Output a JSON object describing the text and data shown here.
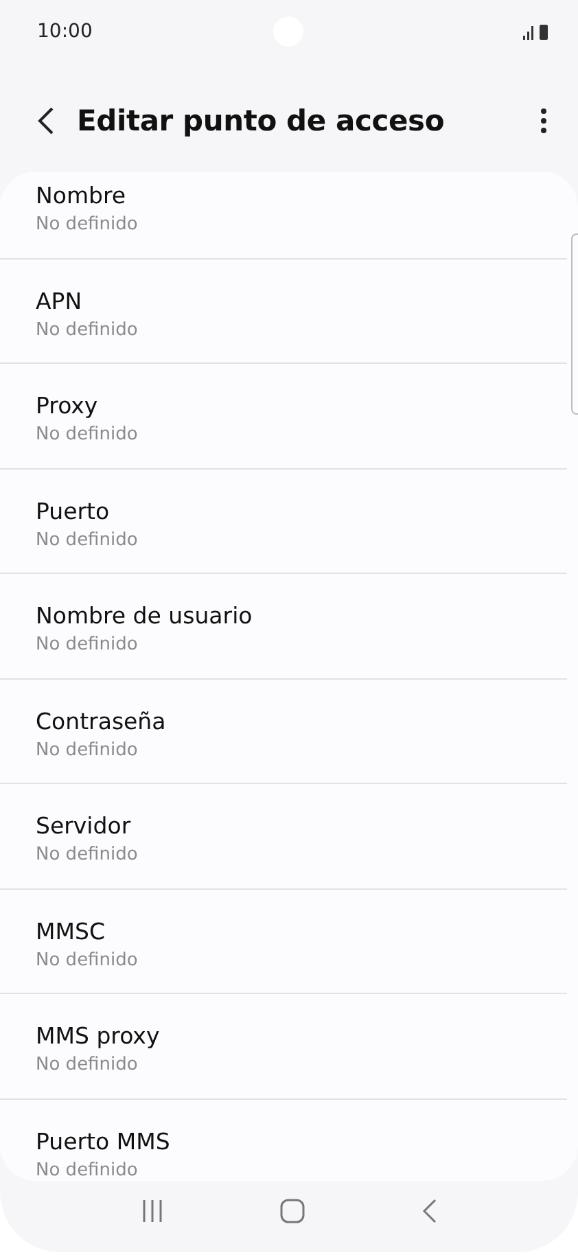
{
  "status_bar": {
    "time": "10:00"
  },
  "header": {
    "title": "Editar punto de acceso"
  },
  "settings": [
    {
      "label": "Nombre",
      "value": "No definido"
    },
    {
      "label": "APN",
      "value": "No definido"
    },
    {
      "label": "Proxy",
      "value": "No definido"
    },
    {
      "label": "Puerto",
      "value": "No definido"
    },
    {
      "label": "Nombre de usuario",
      "value": "No definido"
    },
    {
      "label": "Contraseña",
      "value": "No definido"
    },
    {
      "label": "Servidor",
      "value": "No definido"
    },
    {
      "label": "MMSC",
      "value": "No definido"
    },
    {
      "label": "MMS proxy",
      "value": "No definido"
    },
    {
      "label": "Puerto MMS",
      "value": "No definido"
    }
  ]
}
